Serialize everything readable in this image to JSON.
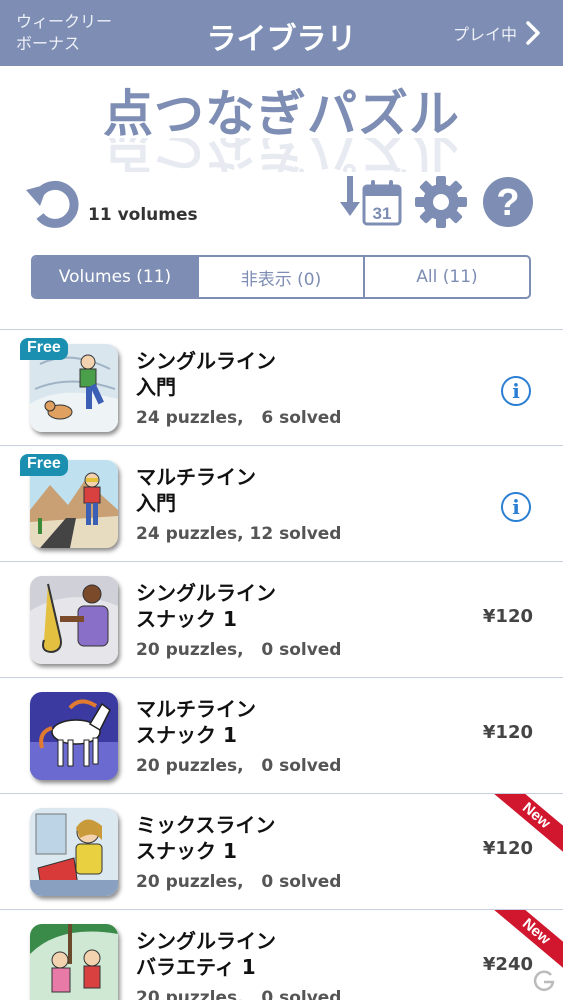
{
  "nav": {
    "left_line1": "ウィークリー",
    "left_line2": "ボーナス",
    "title": "ライブラリ",
    "right_label": "プレイ中"
  },
  "logo_text": "点つなぎパズル",
  "toolbar": {
    "volume_count": "11 volumes",
    "refresh_icon": "refresh-icon",
    "sort_icon": "sort-by-date-icon",
    "calendar_day": "31",
    "settings_icon": "gear-icon",
    "help_icon": "help-icon"
  },
  "tabs": [
    {
      "label": "Volumes (11)",
      "active": true
    },
    {
      "label": "非表示 (0)",
      "active": false
    },
    {
      "label": "All (11)",
      "active": false
    }
  ],
  "volumes": [
    {
      "title1": "シングルライン",
      "title2": "入門",
      "stats": "24 puzzles,   6 solved",
      "badge": "Free",
      "price": "",
      "info": "i"
    },
    {
      "title1": "マルチライン",
      "title2": "入門",
      "stats": "24 puzzles, 12 solved",
      "badge": "Free",
      "price": "",
      "info": "i"
    },
    {
      "title1": "シングルライン",
      "title2": "スナック 1",
      "stats": "20 puzzles,   0 solved",
      "badge": "",
      "price": "¥120"
    },
    {
      "title1": "マルチライン",
      "title2": "スナック 1",
      "stats": "20 puzzles,   0 solved",
      "badge": "",
      "price": "¥120"
    },
    {
      "title1": "ミックスライン",
      "title2": "スナック 1",
      "stats": "20 puzzles,   0 solved",
      "badge": "",
      "price": "¥120",
      "ribbon": "New"
    },
    {
      "title1": "シングルライン",
      "title2": "バラエティ 1",
      "stats": "20 puzzles,   0 solved",
      "badge": "",
      "price": "¥240",
      "ribbon": "New"
    }
  ],
  "colors": {
    "nav_bg": "#7d8db3",
    "accent": "#7d8db3",
    "free_badge": "#1a8fb0",
    "new_ribbon": "#d1172d",
    "info_blue": "#2a7fd4"
  }
}
